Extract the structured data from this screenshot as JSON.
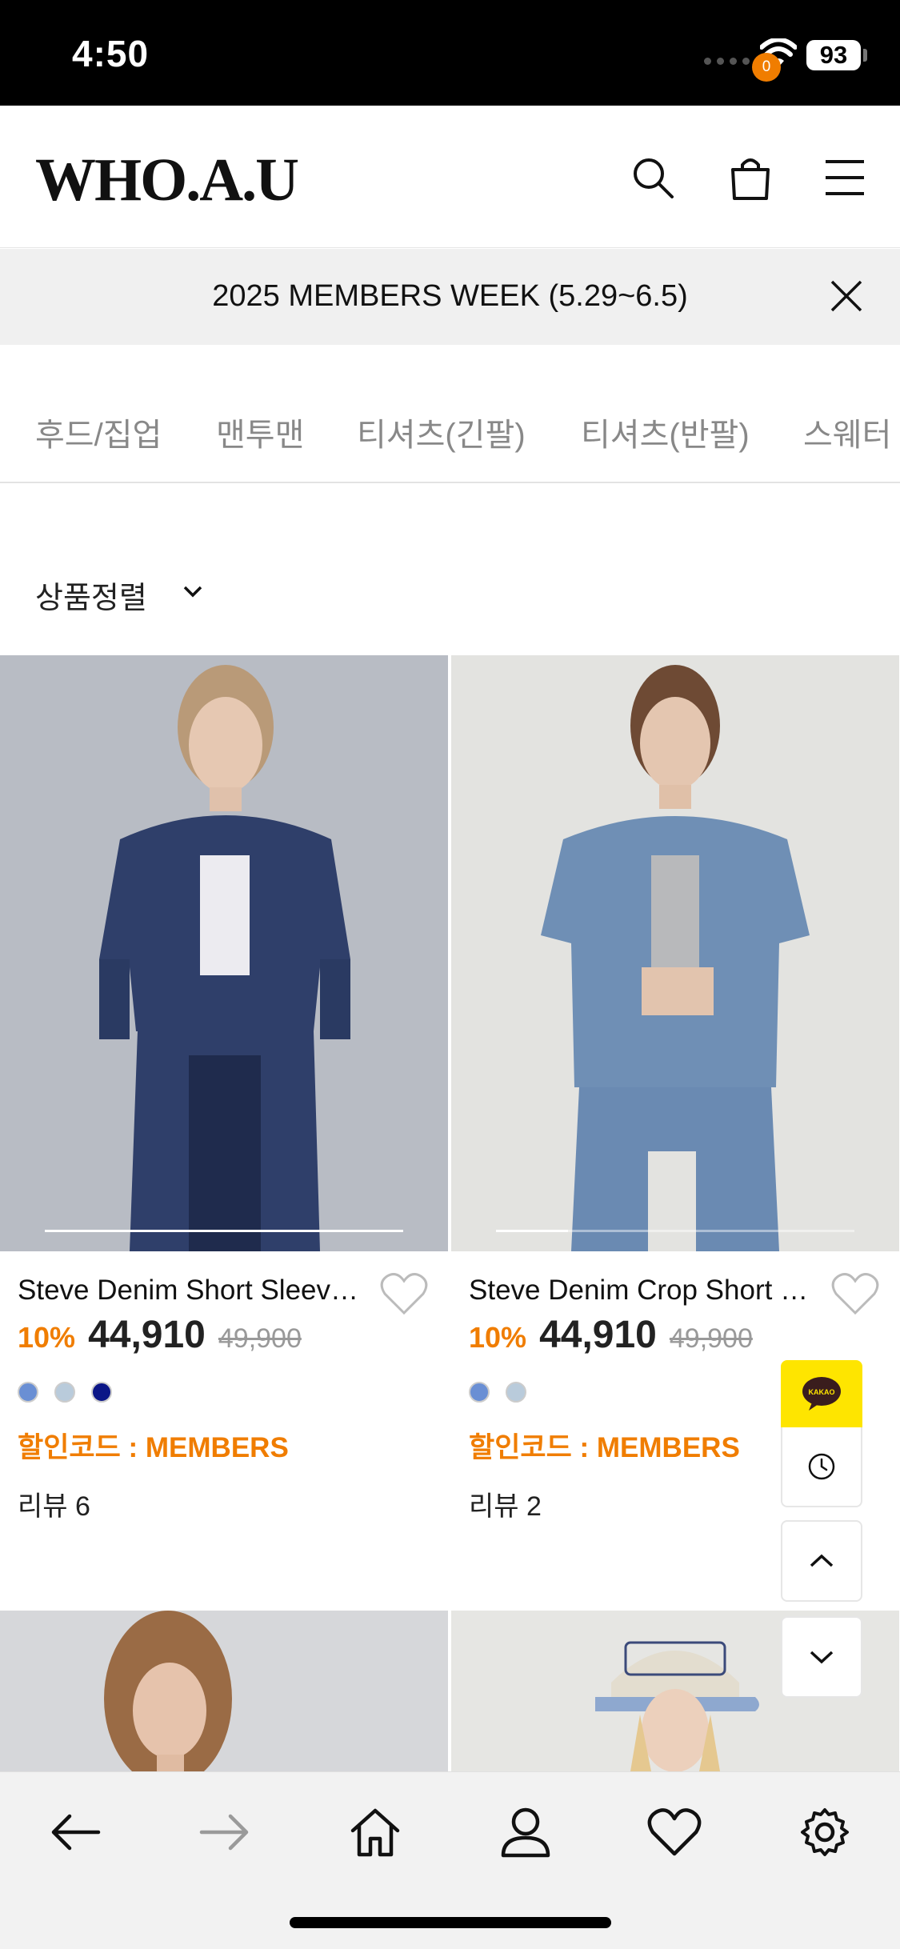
{
  "status_bar": {
    "time": "4:50",
    "battery": "93"
  },
  "header": {
    "logo": "WHO.A.U",
    "cart_count": "0"
  },
  "promo": {
    "text": "2025 MEMBERS WEEK (5.29~6.5)"
  },
  "categories": [
    "후드/집업",
    "맨투맨",
    "티셔츠(긴팔)",
    "티셔츠(반팔)",
    "스웨터"
  ],
  "sort": {
    "label": "상품정렬"
  },
  "products": [
    {
      "name": "Steve Denim Short Sleeve Shirt",
      "discount": "10%",
      "price": "44,910",
      "original_price": "49,900",
      "coupon": "할인코드 : MEMBERS",
      "reviews": "리뷰 6",
      "swatches": [
        "#6a8fd4",
        "#b9cbdb",
        "#0b1687"
      ]
    },
    {
      "name": "Steve Denim Crop Short Sleeve Shirt",
      "discount": "10%",
      "price": "44,910",
      "original_price": "49,900",
      "coupon": "할인코드 : MEMBERS",
      "reviews": "리뷰 2",
      "swatches": [
        "#6a8fd4",
        "#b9cbdb"
      ]
    }
  ],
  "floating": {
    "kakao_label": "KAKAO"
  },
  "colors": {
    "accent": "#f07d00",
    "kakao": "#fee500"
  },
  "bottom_nav": [
    "back-icon",
    "forward-icon",
    "home-icon",
    "user-icon",
    "heart-icon",
    "settings-icon"
  ]
}
